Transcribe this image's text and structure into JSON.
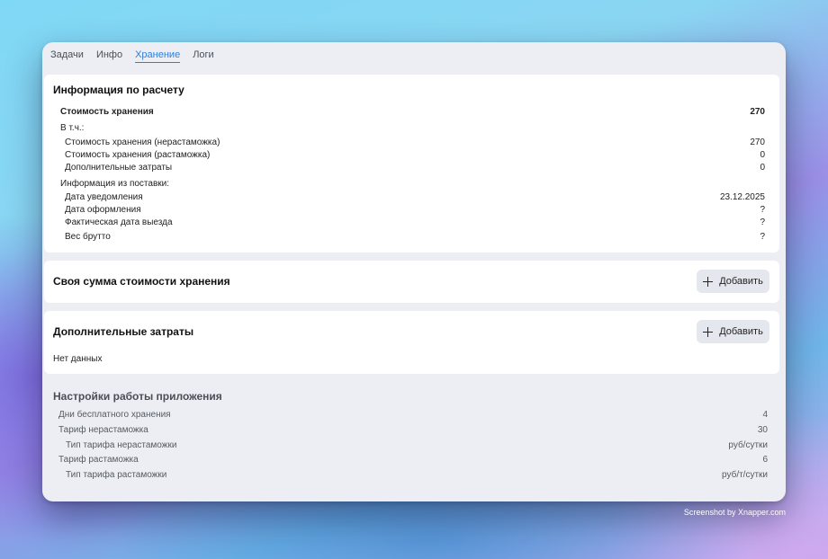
{
  "tabs": [
    "Задачи",
    "Инфо",
    "Хранение",
    "Логи"
  ],
  "active_tab": "Хранение",
  "calc": {
    "title": "Информация по расчету",
    "total_label": "Стоимость хранения",
    "total_value": "270",
    "incl_label": "В т.ч.:",
    "items": [
      {
        "label": "Стоимость хранения (нерастаможка)",
        "value": "270"
      },
      {
        "label": "Стоимость хранения (растаможка)",
        "value": "0"
      },
      {
        "label": "Дополнительные затраты",
        "value": "0"
      }
    ],
    "delivery_label": "Информация из поставки:",
    "delivery": [
      {
        "label": "Дата уведомления",
        "value": "23.12.2025"
      },
      {
        "label": "Дата оформления",
        "value": "?"
      },
      {
        "label": "Фактическая дата выезда",
        "value": "?"
      },
      {
        "label": "Вес брутто",
        "value": "?"
      }
    ]
  },
  "own_sum": {
    "title": "Своя сумма стоимости хранения",
    "add_label": "Добавить"
  },
  "extra": {
    "title": "Дополнительные затраты",
    "add_label": "Добавить",
    "empty_text": "Нет данных"
  },
  "settings": {
    "title": "Настройки работы приложения",
    "rows": [
      {
        "label": "Дни бесплатного хранения",
        "value": "4"
      },
      {
        "label": "Тариф нерастаможка",
        "value": "30"
      },
      {
        "label": "Тип тарифа нерастаможки",
        "value": "руб/сутки"
      },
      {
        "label": "Тариф растаможка",
        "value": "6"
      },
      {
        "label": "Тип тарифа растаможки",
        "value": "руб/т/сутки"
      }
    ]
  },
  "watermark": "Screenshot by Xnapper.com",
  "colors": {
    "accent": "#2f7fd8",
    "window_bg": "#eceef3",
    "card_bg": "#ffffff",
    "button_bg": "#e4e7ed"
  }
}
